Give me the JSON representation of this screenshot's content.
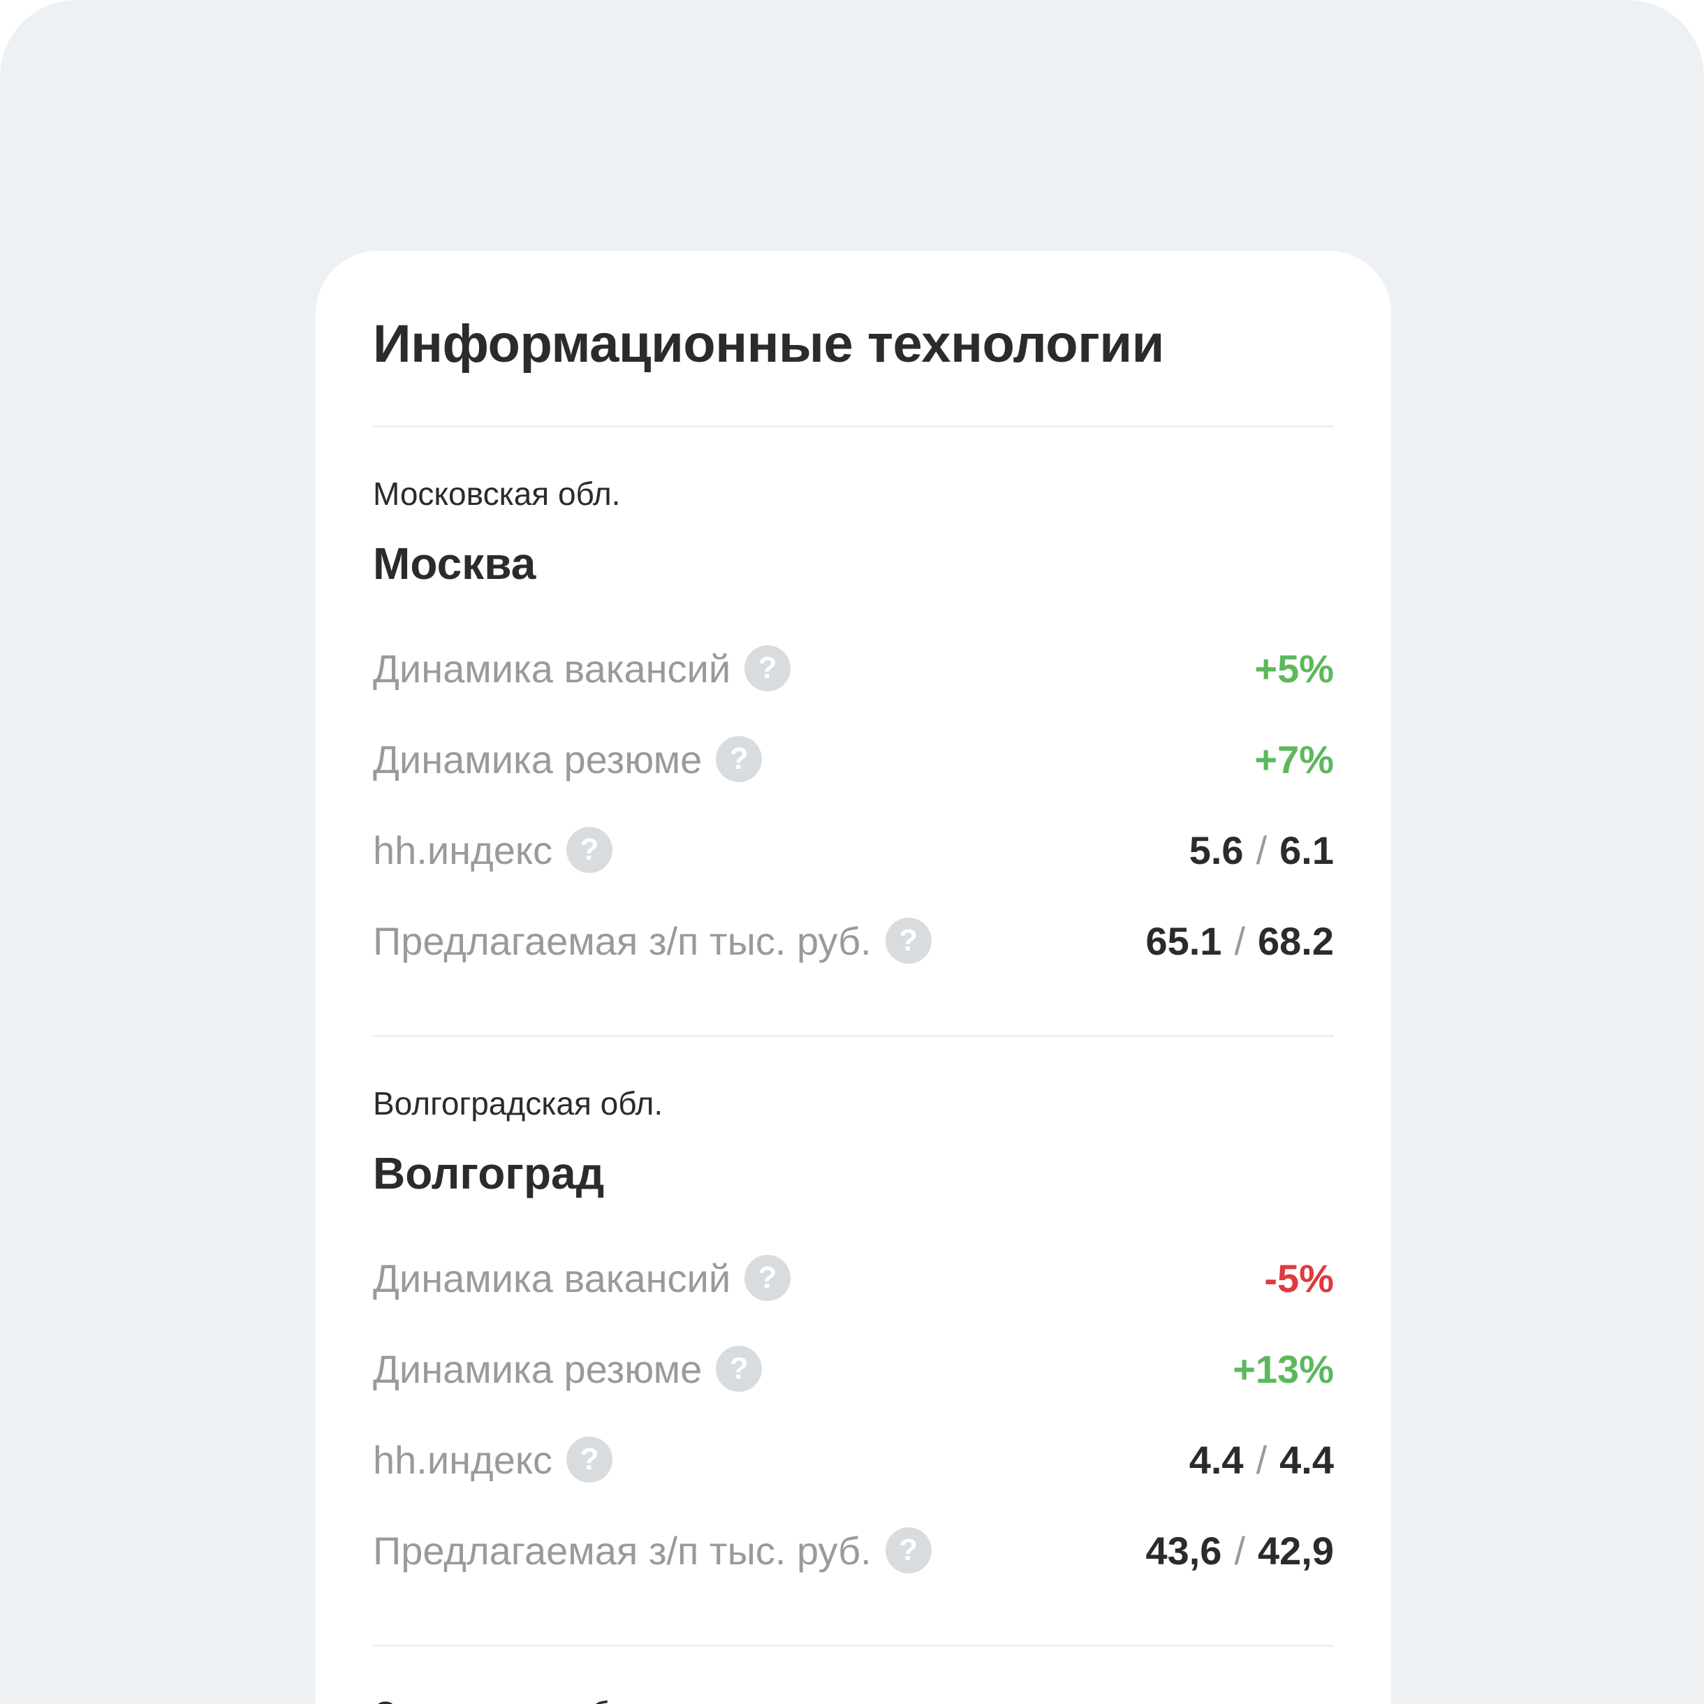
{
  "colors": {
    "positive": "#5cb85c",
    "negative": "#e0393e",
    "label": "#9a9a9a",
    "text": "#2b2b2b",
    "background": "#eef1f4"
  },
  "card": {
    "title": "Информационные технологии"
  },
  "labels": {
    "vacancies": "Динамика вакансий",
    "resumes": "Динамика резюме",
    "hh_index": "hh.индекс",
    "salary": "Предлагаемая з/п тыс. руб.",
    "help_glyph": "?",
    "separator": "/"
  },
  "regions": [
    {
      "region": "Московская обл.",
      "city": "Москва",
      "vacancies": "+5%",
      "resumes": "+7%",
      "hh_index_a": "5.6",
      "hh_index_b": "6.1",
      "salary_a": "65.1",
      "salary_b": "68.2"
    },
    {
      "region": "Волгоградская обл.",
      "city": "Волгоград",
      "vacancies": "-5%",
      "resumes": "+13%",
      "hh_index_a": "4.4",
      "hh_index_b": "4.4",
      "salary_a": "43,6",
      "salary_b": "42,9"
    },
    {
      "region": "Саратовская обл."
    }
  ]
}
